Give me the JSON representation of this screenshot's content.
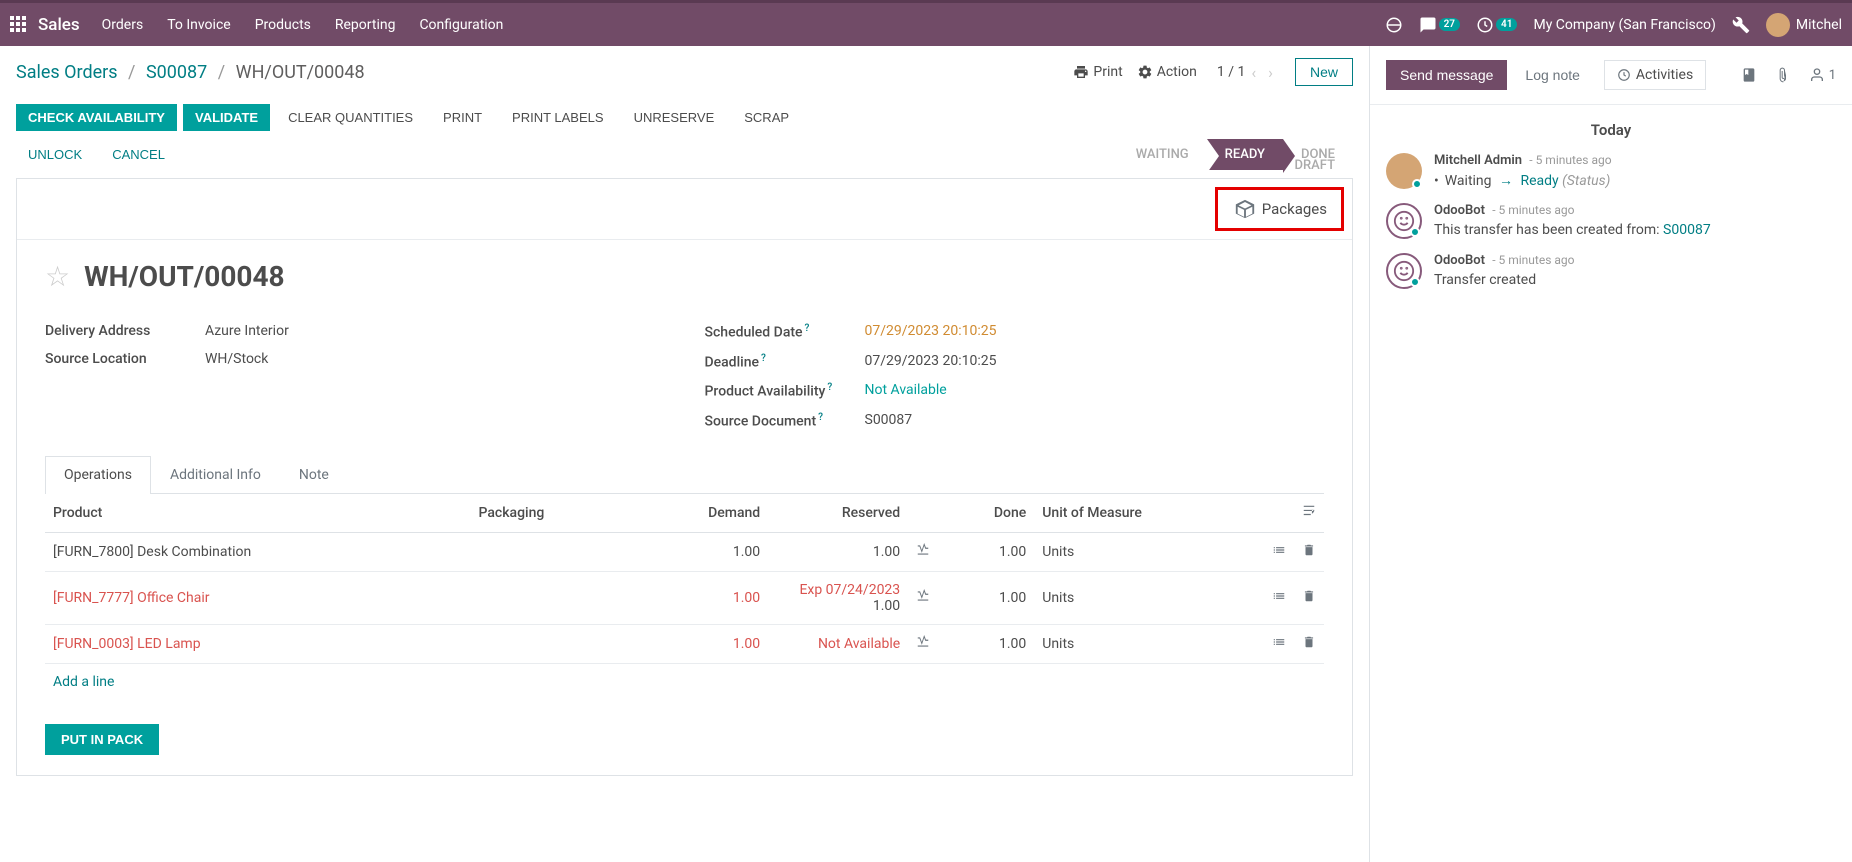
{
  "topbar": {
    "brand": "Sales",
    "nav": [
      "Orders",
      "To Invoice",
      "Products",
      "Reporting",
      "Configuration"
    ],
    "messages_badge": "27",
    "activities_badge": "41",
    "company": "My Company (San Francisco)",
    "user": "Mitchel"
  },
  "breadcrumb": {
    "root": "Sales Orders",
    "order": "S00087",
    "current": "WH/OUT/00048"
  },
  "control_panel": {
    "print": "Print",
    "action": "Action",
    "pager": "1 / 1",
    "new_btn": "New"
  },
  "statusbar": {
    "check_availability": "CHECK AVAILABILITY",
    "validate": "VALIDATE",
    "clear_quantities": "CLEAR QUANTITIES",
    "print": "PRINT",
    "print_labels": "PRINT LABELS",
    "unreserve": "UNRESERVE",
    "scrap": "SCRAP",
    "unlock": "UNLOCK",
    "cancel": "CANCEL",
    "draft": "DRAFT",
    "steps": [
      "WAITING",
      "READY",
      "DONE"
    ]
  },
  "packages_btn": "Packages",
  "doc_title": "WH/OUT/00048",
  "fields": {
    "delivery_address_label": "Delivery Address",
    "delivery_address": "Azure Interior",
    "source_location_label": "Source Location",
    "source_location": "WH/Stock",
    "scheduled_date_label": "Scheduled Date",
    "scheduled_date": "07/29/2023 20:10:25",
    "deadline_label": "Deadline",
    "deadline": "07/29/2023 20:10:25",
    "product_availability_label": "Product Availability",
    "product_availability": "Not Available",
    "source_document_label": "Source Document",
    "source_document": "S00087"
  },
  "tabs": {
    "operations": "Operations",
    "additional_info": "Additional Info",
    "note": "Note"
  },
  "table": {
    "headers": {
      "product": "Product",
      "packaging": "Packaging",
      "demand": "Demand",
      "reserved": "Reserved",
      "done": "Done",
      "uom": "Unit of Measure"
    },
    "rows": [
      {
        "product": "[FURN_7800] Desk Combination",
        "packaging": "",
        "demand": "1.00",
        "reserved": "1.00",
        "reserved_note": "",
        "reserved_class": "",
        "done": "1.00",
        "uom": "Units"
      },
      {
        "product": "[FURN_7777] Office Chair",
        "packaging": "",
        "demand": "1.00",
        "reserved": "1.00",
        "reserved_note": "Exp 07/24/2023",
        "reserved_class": "red",
        "done": "1.00",
        "uom": "Units",
        "product_class": "red",
        "demand_class": "red"
      },
      {
        "product": "[FURN_0003] LED Lamp",
        "packaging": "",
        "demand": "1.00",
        "reserved": "",
        "reserved_note": "Not Available",
        "reserved_class": "red",
        "done": "1.00",
        "uom": "Units",
        "product_class": "red",
        "demand_class": "red"
      }
    ],
    "add_line": "Add a line"
  },
  "put_in_pack": "PUT IN PACK",
  "chatter": {
    "send_message": "Send message",
    "log_note": "Log note",
    "activities": "Activities",
    "follower_count": "1",
    "today": "Today",
    "messages": [
      {
        "author": "Mitchell Admin",
        "time": "- 5 minutes ago",
        "type": "status",
        "from_status": "Waiting",
        "to_status": "Ready",
        "field": "(Status)"
      },
      {
        "author": "OdooBot",
        "time": "- 5 minutes ago",
        "type": "text",
        "text_prefix": "This transfer has been created from: ",
        "link": "S00087"
      },
      {
        "author": "OdooBot",
        "time": "- 5 minutes ago",
        "type": "text",
        "text_prefix": "Transfer created",
        "link": ""
      }
    ]
  }
}
